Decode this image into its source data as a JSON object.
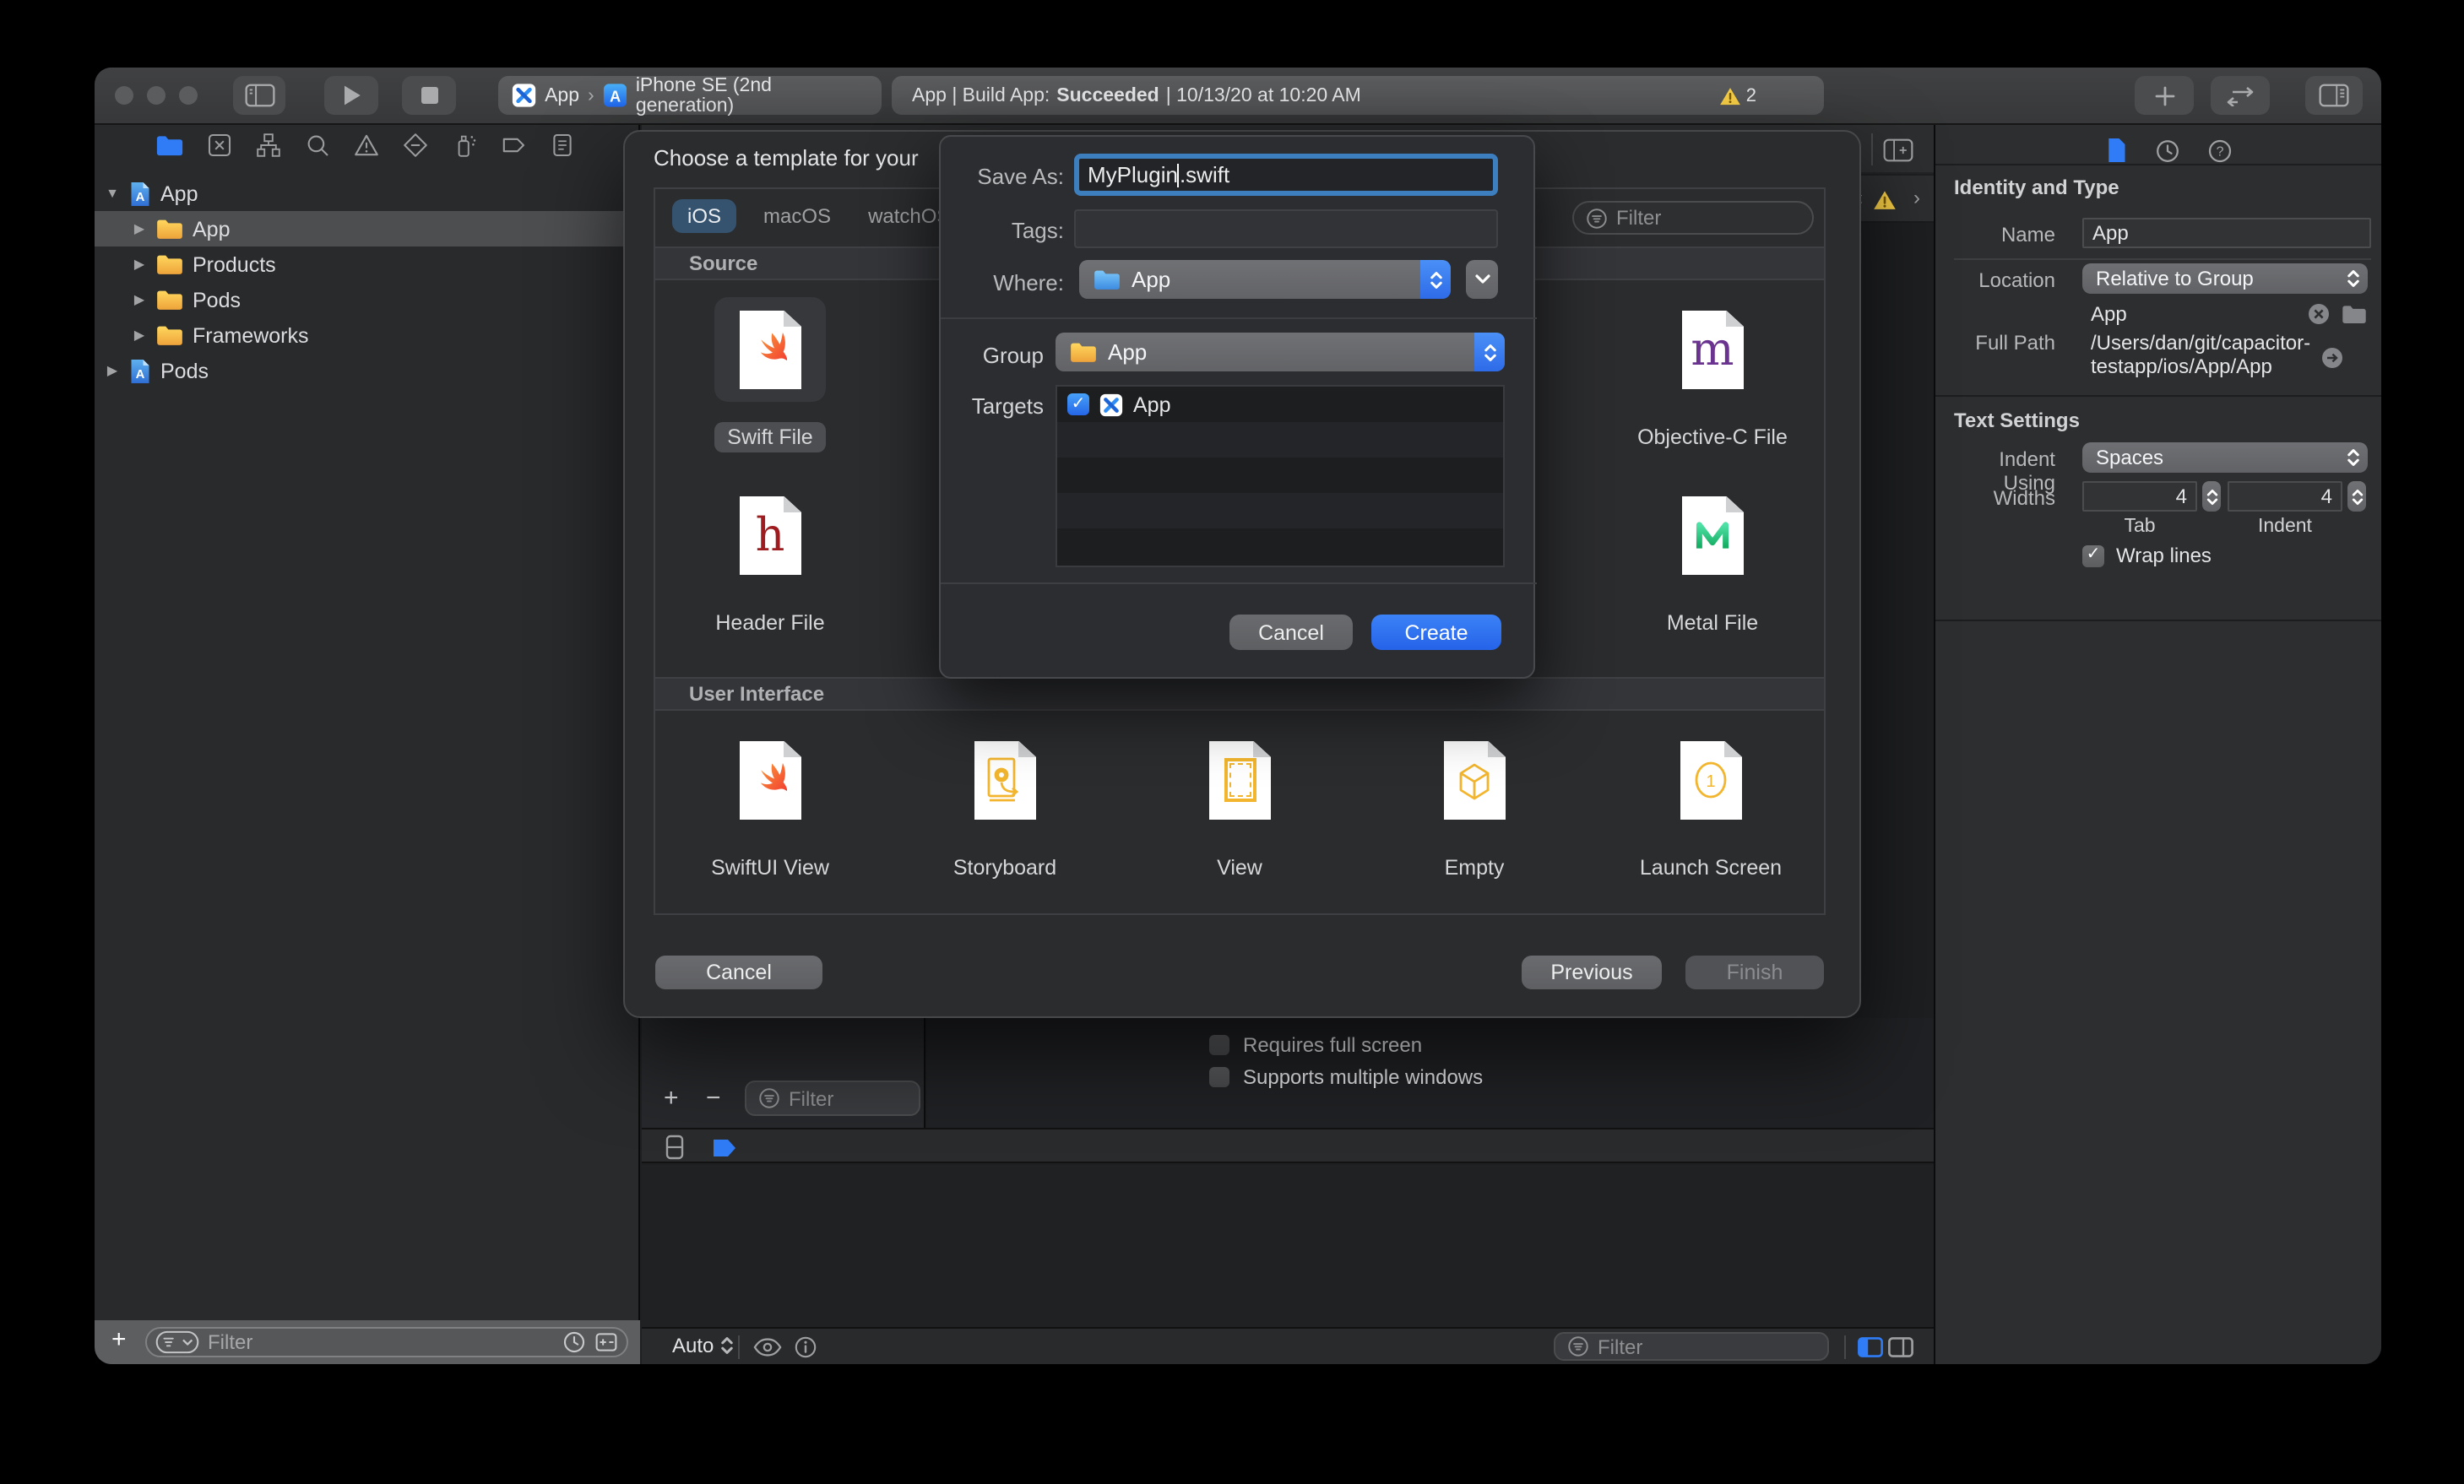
{
  "toolbar": {
    "scheme_app": "App",
    "scheme_separator": "›",
    "scheme_device": "iPhone SE (2nd generation)",
    "status_left": "App | Build App:",
    "status_state": "Succeeded",
    "status_right": "| 10/13/20 at 10:20 AM",
    "warning_count": "2"
  },
  "navigator": {
    "rows": [
      {
        "label": "App",
        "icon": "project"
      },
      {
        "label": "App",
        "icon": "folder"
      },
      {
        "label": "Products",
        "icon": "folder"
      },
      {
        "label": "Pods",
        "icon": "folder"
      },
      {
        "label": "Frameworks",
        "icon": "folder"
      },
      {
        "label": "Pods",
        "icon": "project"
      }
    ],
    "filter_placeholder": "Filter"
  },
  "dialog": {
    "title": "Choose a template for your",
    "tabs": [
      {
        "label": "iOS",
        "selected": true
      },
      {
        "label": "macOS",
        "selected": false
      },
      {
        "label": "watchOS",
        "selected": false
      }
    ],
    "filter_placeholder": "Filter",
    "sections": [
      {
        "title": "Source",
        "items": [
          {
            "label": "Swift File",
            "icon": "swift-doc",
            "selected": true
          },
          {
            "label": "Header File",
            "icon": "h-doc",
            "selected": false
          },
          {
            "label": "Objective-C File",
            "icon": "m-doc",
            "selected": false
          },
          {
            "label": "Metal File",
            "icon": "metal-doc",
            "selected": false
          }
        ]
      },
      {
        "title": "User Interface",
        "items": [
          {
            "label": "SwiftUI View",
            "icon": "swift-doc"
          },
          {
            "label": "Storyboard",
            "icon": "storyboard-doc"
          },
          {
            "label": "View",
            "icon": "view-doc"
          },
          {
            "label": "Empty",
            "icon": "empty-doc"
          },
          {
            "label": "Launch Screen",
            "icon": "launch-doc"
          }
        ]
      }
    ],
    "cancel_label": "Cancel",
    "previous_label": "Previous",
    "finish_label": "Finish"
  },
  "sheet": {
    "save_as_label": "Save As:",
    "filename_before_cursor": "MyPlugin",
    "filename_after_cursor": ".swift",
    "tags_label": "Tags:",
    "where_label": "Where:",
    "where_value": "App",
    "group_label": "Group",
    "group_value": "App",
    "targets_label": "Targets",
    "target_name": "App",
    "target_checked": true,
    "cancel_label": "Cancel",
    "create_label": "Create"
  },
  "inspector": {
    "identity": {
      "title": "Identity and Type",
      "name_label": "Name",
      "name_value": "App",
      "location_label": "Location",
      "location_value": "Relative to Group",
      "location_file": "App",
      "full_path_label": "Full Path",
      "full_path_line1": "/Users/dan/git/capacitor-",
      "full_path_line2": "testapp/ios/App/App"
    },
    "text_settings": {
      "title": "Text Settings",
      "indent_label": "Indent Using",
      "indent_value": "Spaces",
      "widths_label": "Widths",
      "tab_width": "4",
      "tab_label": "Tab",
      "indent_width": "4",
      "indent_width_label": "Indent",
      "wrap_label": "Wrap lines"
    }
  },
  "editor": {
    "checkbox1": "Requires full screen",
    "checkbox2": "Supports multiple windows",
    "add_label": "+",
    "remove_label": "−",
    "filter_placeholder": "Filter",
    "auto_label": "Auto",
    "console_filter_placeholder": "Filter"
  },
  "colors": {
    "accent_blue": "#2f7cf6",
    "create_blue": "#2e6be8",
    "warning_yellow": "#f7ce46",
    "folder_yellow": "#f2ae38",
    "selected_tab_blue": "#35536f"
  }
}
